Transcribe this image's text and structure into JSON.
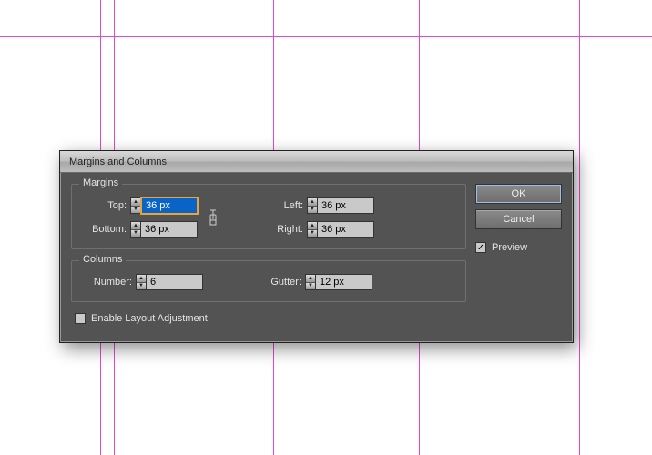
{
  "dialog": {
    "title": "Margins and Columns"
  },
  "margins": {
    "legend": "Margins",
    "top_label": "Top:",
    "top_value": "36 px",
    "bottom_label": "Bottom:",
    "bottom_value": "36 px",
    "left_label": "Left:",
    "left_value": "36 px",
    "right_label": "Right:",
    "right_value": "36 px"
  },
  "columns": {
    "legend": "Columns",
    "number_label": "Number:",
    "number_value": "6",
    "gutter_label": "Gutter:",
    "gutter_value": "12 px"
  },
  "buttons": {
    "ok": "OK",
    "cancel": "Cancel"
  },
  "preview": {
    "label": "Preview",
    "checked": "✓"
  },
  "adjust": {
    "label": "Enable Layout Adjustment"
  }
}
